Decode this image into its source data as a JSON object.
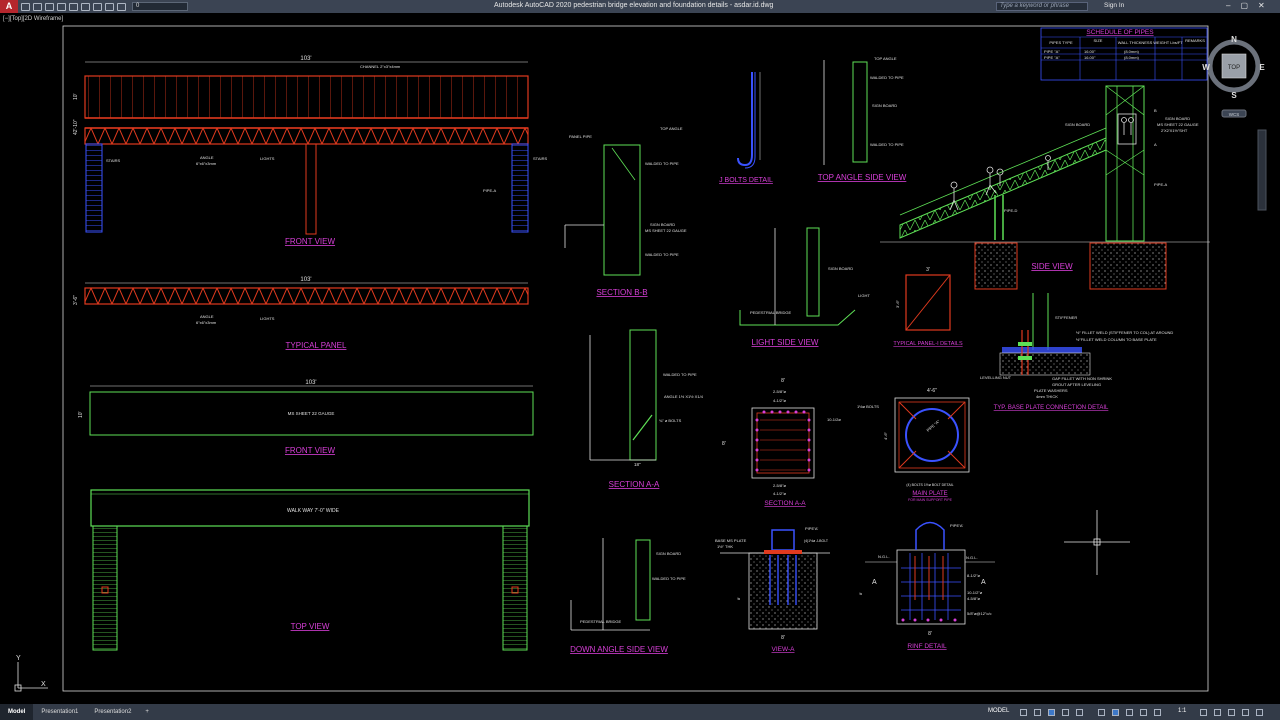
{
  "window": {
    "app_logo": "A",
    "title": "Autodesk AutoCAD 2020   pedestrian bridge elevation and foundation details - asdar.id.dwg",
    "layer_value": "0",
    "search_placeholder": "Type a keyword or phrase",
    "sign_in": "Sign In",
    "viewport_label": "[−][Top][2D Wireframe]"
  },
  "viewcube": {
    "top": "TOP",
    "n": "N",
    "s": "S",
    "e": "E",
    "w": "W",
    "wcs": "WCS"
  },
  "statusbar": {
    "tabs": [
      "Model",
      "Presentation1",
      "Presentation2",
      "+"
    ],
    "mode": "MODEL",
    "scale": "1:1"
  },
  "drawing": {
    "front_view_top": {
      "dim_length": "103'",
      "dim_height": "10'",
      "dim_total": "42'-10\"",
      "channel_note": "CHANNEL 2\"x3\"x4mm",
      "stairs_left": "STAIRS",
      "stairs_right": "STAIRS",
      "angle_note": "ANGLE",
      "angle_size": "6\"x6\"x3mm",
      "lights": "LIGHTS",
      "pipe_a": "PIPE-A",
      "title": "FRONT  VIEW"
    },
    "typical_panel": {
      "dim_length": "103'",
      "dim_height": "3'-6\"",
      "angle_note": "ANGLE",
      "angle_size": "6\"x6\"x3mm",
      "lights": "LIGHTS",
      "title": "TYPICAL  PANEL"
    },
    "front_view_sheet": {
      "dim_length": "103'",
      "dim_height": "10'",
      "sheet_note": "MS SHEET 22 GAUGE",
      "title": "FRONT  VIEW"
    },
    "top_view": {
      "walkway": "WALK WAY 7'-0\" WIDE",
      "title": "TOP  VIEW"
    },
    "section_bb": {
      "panel_pipe": "PANEL PIPE",
      "top_angle": "TOP ANGLE",
      "walded": "WALDED TO PIPE",
      "sign_board": "SIGN BOARD",
      "ms_sheet": "MS SHEET 22 GAUGE",
      "walded2": "WALDED TO PIPE",
      "title": "SECTION  B-B"
    },
    "section_aa": {
      "walded": "WALDED TO PIPE",
      "angle": "ANGLE 1½ X1½ X1/4",
      "bolts": "¾\" ø BOLTS",
      "dim": "18\"",
      "title": "SECTION  A-A"
    },
    "down_angle": {
      "sign_board": "SIGN BOARD",
      "walded": "WALDED TO PIPE",
      "bridge": "PEDESTRIAL BRIDGE",
      "title": "DOWN  ANGLE  SIDE  VIEW"
    },
    "j_bolts": {
      "title": "J  BOLTS  DETAIL"
    },
    "top_angle_side": {
      "top_angle": "TOP ANGLE",
      "walded": "WALDED TO PIPE",
      "sign_board": "SIGN BOARD",
      "walded2": "WALDED TO PIPE",
      "title": "TOP  ANGLE  SIDE  VIEW"
    },
    "light_side": {
      "sign_board": "SIGN BOARD",
      "light": "LIGHT",
      "bridge": "PEDESTRIAL BRIDGE",
      "title": "LIGHT  SIDE  VIEW"
    },
    "typical_panel_detail": {
      "dim_w": "3'",
      "dim_h": "3'-6\"",
      "title": "TYPICAL PANEL-I DETAILS"
    },
    "section_aa_plate": {
      "dim_top": "8'",
      "dim_a": "2-5/8\"ø",
      "dim_b": "4-1/2\"ø",
      "dim_side": "10-1/2ø",
      "dim_left": "8'",
      "dim_c": "2-5/8\"ø",
      "dim_d": "4-1/2\"ø",
      "title": "SECTION  A-A"
    },
    "main_plate": {
      "dim_w": "4'-6\"",
      "dim_h": "4'-6\"",
      "bolts": "1½ø BOLTS",
      "pipe": "PIPE \"A\"",
      "note": "(4) BOLTS 1½ø BOLT DETAIL",
      "title": "MAIN PLATE",
      "subtitle": "FOR MAIN SUPPORT PIPE"
    },
    "view_a": {
      "pipe": "PIPE'A'",
      "base_plate": "BASE MS PLATE",
      "thk": "1½\" THK",
      "bolts": "(4)1½ø J-BOLT",
      "dim_h": "8'",
      "dim_w": "8'",
      "title": "VIEW-A"
    },
    "rinf_detail": {
      "pipe": "PIPE'A'",
      "ngl_l": "N.G.L.",
      "ngl_r": "N.G.L.",
      "a_l": "A",
      "a_r": "A",
      "d1": "8-1/2\"ø",
      "d2": "10-1/2\"ø",
      "d3": "4-5/8\"ø",
      "d4": "5/8\"ø@12\"c/c",
      "dim_h": "8'",
      "dim_w": "8'",
      "title": "RINF DETAIL"
    },
    "side_view": {
      "sign_board": "SIGN BOARD",
      "b": "B",
      "a": "A",
      "sign_board2": "SIGN BOARD",
      "ms_sheet": "MS SHEET 22 GAUGE",
      "size": "2'X2'X1½\"SHT",
      "pipe_a": "PIPE-A",
      "pipe_d": "PIPE-D",
      "title": "SIDE  VIEW"
    },
    "base_plate": {
      "stiffener": "STIFFENER",
      "fillet1": "½\" FILLET WELD (STIFFENER TO COL) AT AROUND",
      "fillet2": "½\"FILLET WELD COLUMN TO BASE PLATE",
      "leveling": "LEVELLING NUT",
      "gap": "GAP FILLET WITH NON SHRINK",
      "grout": "GROUT AFTER LEVELING",
      "washers": "PLATE WASHERS",
      "thick": "4mm THICK",
      "title": "TYP. BASE PLATE CONNECTION DETAIL"
    }
  },
  "schedule": {
    "title": "SCHEDULE  OF  PIPES",
    "headers": [
      "PIPES TYPE",
      "SIZE",
      "WALL THICKNESS",
      "WEIGHT Lbs/FT",
      "REMARKS"
    ],
    "rows": [
      [
        "PIPE \"A\"",
        "16.00\"",
        "(8.0mm)",
        "",
        ""
      ],
      [
        "PIPE \"A\"",
        "16.00\"",
        "(8.0mm)",
        "",
        ""
      ]
    ]
  }
}
